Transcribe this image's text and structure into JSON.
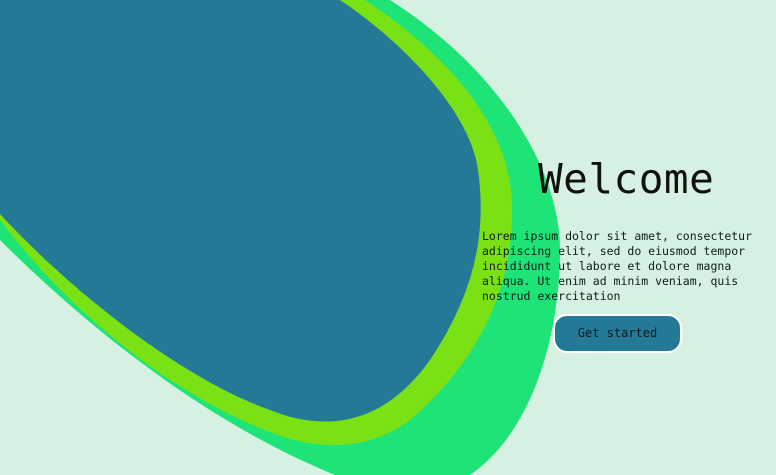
{
  "colors": {
    "background": "#d6f1e2",
    "outer_blob": "#1ee477",
    "middle_blob": "#7ae114",
    "inner_blob": "#237996",
    "button_fill": "#237996",
    "button_border": "#ffffff",
    "text": "#111111"
  },
  "hero": {
    "title": "Welcome",
    "description": "Lorem ipsum dolor sit amet, consectetur adipiscing elit, sed do eiusmod tempor incididunt ut labore et dolore magna aliqua. Ut enim ad minim veniam, quis nostrud exercitation",
    "cta_label": "Get started"
  }
}
